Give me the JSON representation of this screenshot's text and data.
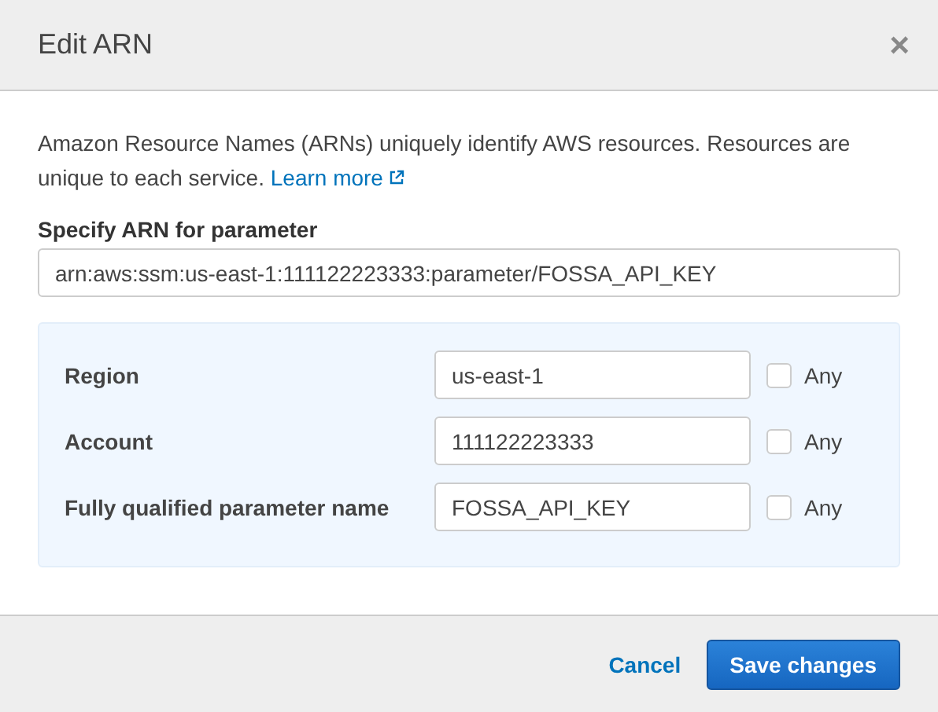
{
  "dialog": {
    "title": "Edit ARN",
    "close": "×"
  },
  "description": {
    "text": "Amazon Resource Names (ARNs) uniquely identify AWS resources. Resources are unique to each service.",
    "link": "Learn more"
  },
  "arn_field": {
    "label": "Specify ARN for parameter",
    "value": "arn:aws:ssm:us-east-1:111122223333:parameter/FOSSA_API_KEY"
  },
  "parts": [
    {
      "label": "Region",
      "value": "us-east-1",
      "any_label": "Any",
      "any_checked": false
    },
    {
      "label": "Account",
      "value": "111122223333",
      "any_label": "Any",
      "any_checked": false
    },
    {
      "label": "Fully qualified parameter name",
      "value": "FOSSA_API_KEY",
      "any_label": "Any",
      "any_checked": false
    }
  ],
  "buttons": {
    "cancel": "Cancel",
    "save": "Save changes"
  }
}
